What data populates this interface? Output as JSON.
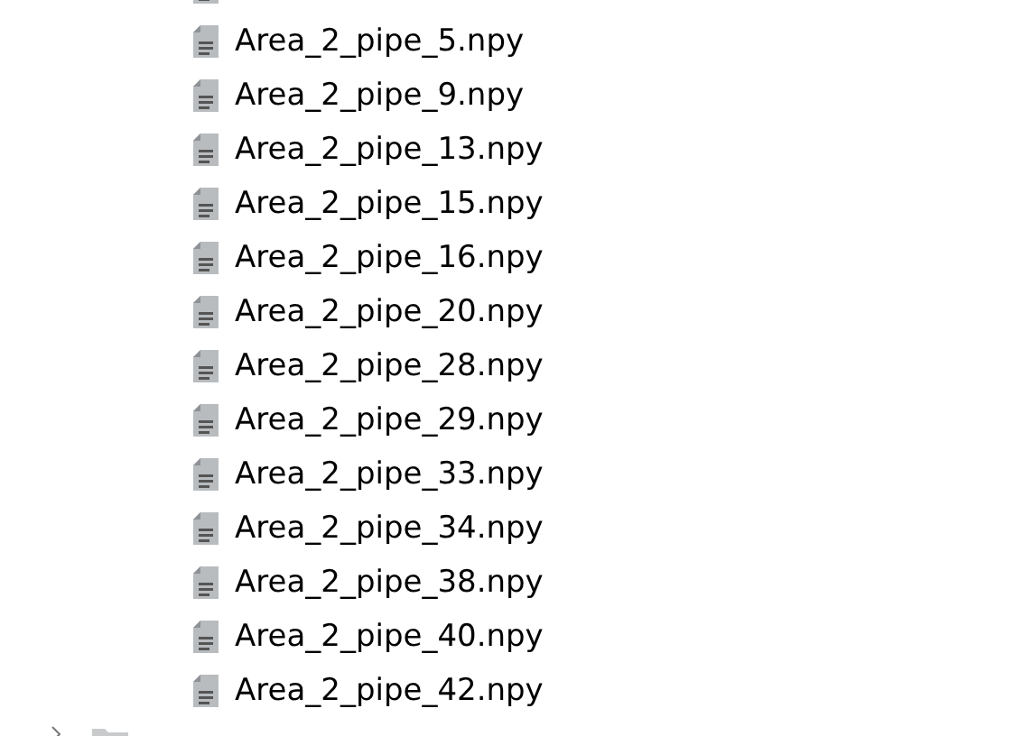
{
  "rows": [
    {
      "kind": "file"
    },
    {
      "kind": "file",
      "name": "Area_2_pipe_5.npy"
    },
    {
      "kind": "file",
      "name": "Area_2_pipe_9.npy"
    },
    {
      "kind": "file",
      "name": "Area_2_pipe_13.npy"
    },
    {
      "kind": "file",
      "name": "Area_2_pipe_15.npy"
    },
    {
      "kind": "file",
      "name": "Area_2_pipe_16.npy"
    },
    {
      "kind": "file",
      "name": "Area_2_pipe_20.npy"
    },
    {
      "kind": "file",
      "name": "Area_2_pipe_28.npy"
    },
    {
      "kind": "file",
      "name": "Area_2_pipe_29.npy"
    },
    {
      "kind": "file",
      "name": "Area_2_pipe_33.npy"
    },
    {
      "kind": "file",
      "name": "Area_2_pipe_34.npy"
    },
    {
      "kind": "file",
      "name": "Area_2_pipe_38.npy"
    },
    {
      "kind": "file",
      "name": "Area_2_pipe_40.npy"
    },
    {
      "kind": "file",
      "name": "Area_2_pipe_42.npy"
    },
    {
      "kind": "folder",
      "expanded": false
    }
  ]
}
